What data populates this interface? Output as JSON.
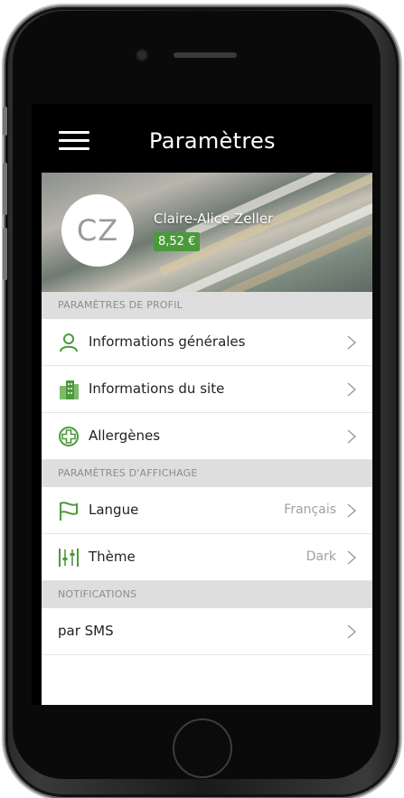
{
  "header": {
    "title": "Paramètres",
    "menu_icon": "hamburger-menu-icon"
  },
  "profile": {
    "initials": "CZ",
    "name": "Claire-Alice Zeller",
    "balance": "8,52 €"
  },
  "sections": {
    "profile": "PARAMÈTRES DE PROFIL",
    "display": "PARAMÈTRES D'AFFICHAGE",
    "notifications": "NOTIFICATIONS"
  },
  "items": {
    "general": {
      "label": "Informations générales",
      "icon": "user-icon"
    },
    "site": {
      "label": "Informations du site",
      "icon": "building-icon"
    },
    "allergens": {
      "label": "Allergènes",
      "icon": "plus-circle-icon"
    },
    "language": {
      "label": "Langue",
      "value": "Français",
      "icon": "flag-icon"
    },
    "theme": {
      "label": "Thème",
      "value": "Dark",
      "icon": "sliders-icon"
    },
    "sms": {
      "label": "par SMS"
    }
  },
  "colors": {
    "accent": "#4a9a3b",
    "section_bg": "#dedede",
    "screen_bg": "#000000"
  }
}
